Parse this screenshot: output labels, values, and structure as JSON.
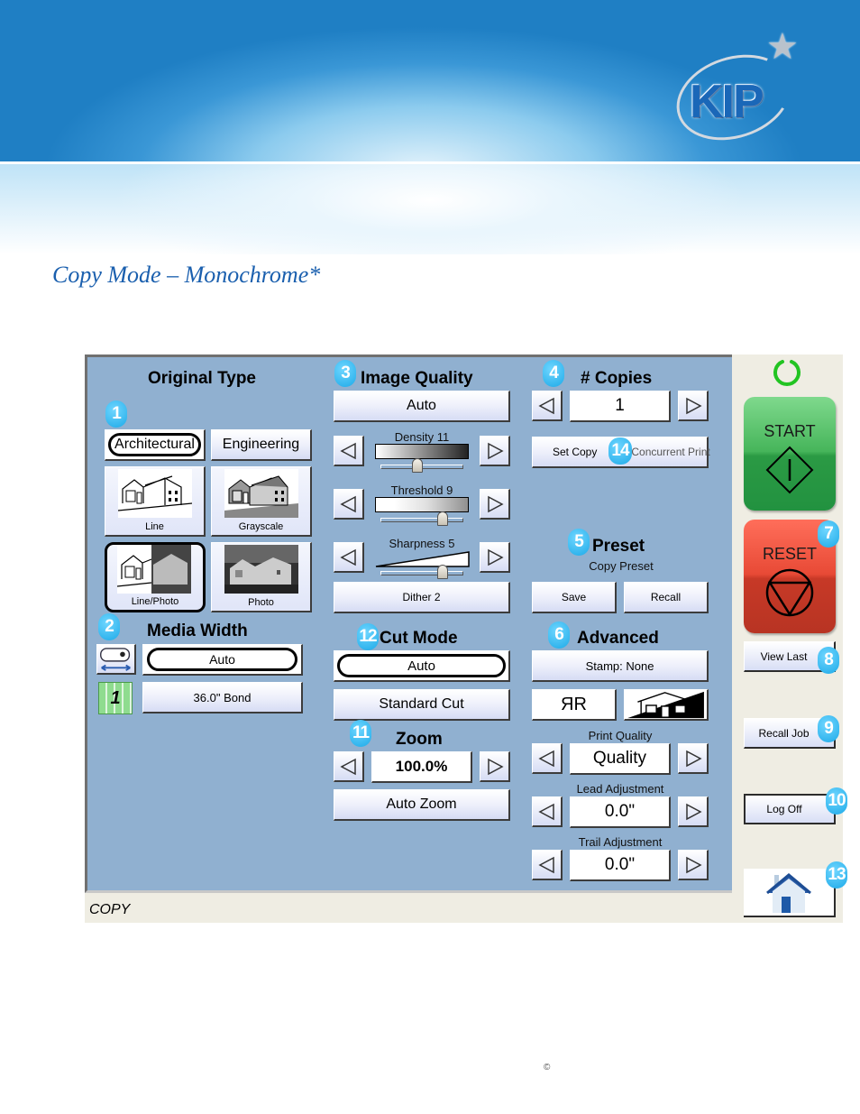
{
  "header": {
    "logo_text": "KIP",
    "page_title": "Copy Mode – Monochrome*"
  },
  "original_type": {
    "heading": "Original Type",
    "badge": "1",
    "modes": [
      {
        "label": "Architectural",
        "selected": true
      },
      {
        "label": "Engineering",
        "selected": false
      }
    ],
    "types": [
      {
        "label": "Line",
        "selected": false
      },
      {
        "label": "Grayscale",
        "selected": false
      },
      {
        "label": "Line/Photo",
        "selected": true
      },
      {
        "label": "Photo",
        "selected": false
      }
    ]
  },
  "media_width": {
    "heading": "Media Width",
    "badge": "2",
    "width_value": "Auto",
    "roll_number": "1",
    "media_value": "36.0\" Bond"
  },
  "image_quality": {
    "heading": "Image Quality",
    "badge": "3",
    "mode_value": "Auto",
    "density": {
      "label": "Density 11",
      "level": 0.45
    },
    "threshold": {
      "label": "Threshold 9",
      "level": 0.75
    },
    "sharpness": {
      "label": "Sharpness 5",
      "level": 0.75
    },
    "dither_label": "Dither 2"
  },
  "cut_mode": {
    "heading": "Cut Mode",
    "badge": "12",
    "mode_value": "Auto",
    "cut_label": "Standard Cut"
  },
  "zoom": {
    "heading": "Zoom",
    "badge": "11",
    "value": "100.0%",
    "auto_label": "Auto Zoom"
  },
  "copies": {
    "heading": "# Copies",
    "badge": "4",
    "value": "1",
    "set_copy_label": "Set Copy",
    "concurrent_label": "Concurrent Print",
    "concurrent_badge": "14"
  },
  "preset": {
    "heading": "Preset",
    "badge": "5",
    "subtitle": "Copy Preset",
    "save_label": "Save",
    "recall_label": "Recall"
  },
  "advanced": {
    "heading": "Advanced",
    "badge": "6",
    "stamp_label": "Stamp: None",
    "mirror_label": "ЯR",
    "print_quality_label": "Print Quality",
    "print_quality_value": "Quality",
    "lead_label": "Lead Adjustment",
    "lead_value": "0.0\"",
    "trail_label": "Trail Adjustment",
    "trail_value": "0.0\""
  },
  "side": {
    "start_label": "START",
    "reset_label": "RESET",
    "reset_badge": "7",
    "view_last_label": "View Last",
    "view_last_badge": "8",
    "recall_job_label": "Recall Job",
    "recall_job_badge": "9",
    "log_off_label": "Log Off",
    "log_off_badge": "10",
    "home_badge": "13"
  },
  "status": {
    "mode": "COPY"
  },
  "footer": {
    "copyright": "©"
  }
}
